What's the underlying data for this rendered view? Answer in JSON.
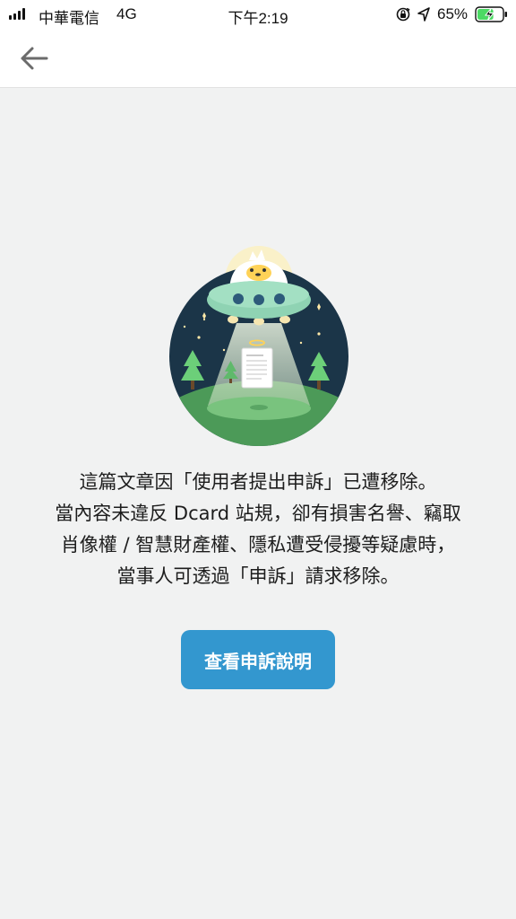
{
  "status_bar": {
    "carrier": "中華電信",
    "network": "4G",
    "time": "下午2:19",
    "battery_percent": "65%",
    "battery_level": 0.65,
    "icons": [
      "signal-bars-icon",
      "orientation-lock-icon",
      "location-arrow-icon",
      "battery-charging-icon"
    ]
  },
  "nav": {
    "back_icon": "back-arrow-icon"
  },
  "illustration": {
    "icon": "ufo-abduction-illustration"
  },
  "message": {
    "lines": [
      "這篇文章因「使用者提出申訴」已遭移除。",
      "當內容未違反 Dcard 站規，卻有損害名譽、竊取",
      "肖像權 / 智慧財產權、隱私遭受侵擾等疑慮時，",
      "當事人可透過「申訴」請求移除。"
    ]
  },
  "action": {
    "appeal_label": "查看申訴說明"
  },
  "colors": {
    "accent": "#3397cf",
    "background": "#f1f2f2",
    "night_sky": "#1b3548",
    "grass": "#4c9a58",
    "battery_green": "#4cd964"
  }
}
